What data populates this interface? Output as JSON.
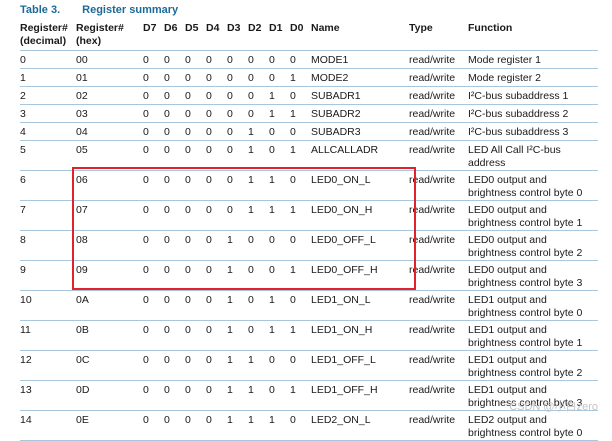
{
  "caption": {
    "label": "Table 3.",
    "title": "Register summary"
  },
  "headers": {
    "decimal": [
      "Register#",
      "(decimal)"
    ],
    "hex": [
      "Register#",
      "(hex)"
    ],
    "bits": [
      "D7",
      "D6",
      "D5",
      "D4",
      "D3",
      "D2",
      "D1",
      "D0"
    ],
    "name": "Name",
    "type": "Type",
    "function": "Function"
  },
  "rows": [
    {
      "dec": "0",
      "hex": "00",
      "bits": [
        "0",
        "0",
        "0",
        "0",
        "0",
        "0",
        "0",
        "0"
      ],
      "name": "MODE1",
      "type": "read/write",
      "fn": [
        "Mode register 1"
      ]
    },
    {
      "dec": "1",
      "hex": "01",
      "bits": [
        "0",
        "0",
        "0",
        "0",
        "0",
        "0",
        "0",
        "1"
      ],
      "name": "MODE2",
      "type": "read/write",
      "fn": [
        "Mode register 2"
      ]
    },
    {
      "dec": "2",
      "hex": "02",
      "bits": [
        "0",
        "0",
        "0",
        "0",
        "0",
        "0",
        "1",
        "0"
      ],
      "name": "SUBADR1",
      "type": "read/write",
      "fn": [
        "I²C-bus subaddress 1"
      ]
    },
    {
      "dec": "3",
      "hex": "03",
      "bits": [
        "0",
        "0",
        "0",
        "0",
        "0",
        "0",
        "1",
        "1"
      ],
      "name": "SUBADR2",
      "type": "read/write",
      "fn": [
        "I²C-bus subaddress 2"
      ]
    },
    {
      "dec": "4",
      "hex": "04",
      "bits": [
        "0",
        "0",
        "0",
        "0",
        "0",
        "1",
        "0",
        "0"
      ],
      "name": "SUBADR3",
      "type": "read/write",
      "fn": [
        "I²C-bus subaddress 3"
      ]
    },
    {
      "dec": "5",
      "hex": "05",
      "bits": [
        "0",
        "0",
        "0",
        "0",
        "0",
        "1",
        "0",
        "1"
      ],
      "name": "ALLCALLADR",
      "type": "read/write",
      "fn": [
        "LED All Call I²C-bus",
        "address"
      ]
    },
    {
      "dec": "6",
      "hex": "06",
      "bits": [
        "0",
        "0",
        "0",
        "0",
        "0",
        "1",
        "1",
        "0"
      ],
      "name": "LED0_ON_L",
      "type": "read/write",
      "fn": [
        "LED0 output and",
        "brightness control byte 0"
      ]
    },
    {
      "dec": "7",
      "hex": "07",
      "bits": [
        "0",
        "0",
        "0",
        "0",
        "0",
        "1",
        "1",
        "1"
      ],
      "name": "LED0_ON_H",
      "type": "read/write",
      "fn": [
        "LED0 output and",
        "brightness control byte 1"
      ]
    },
    {
      "dec": "8",
      "hex": "08",
      "bits": [
        "0",
        "0",
        "0",
        "0",
        "1",
        "0",
        "0",
        "0"
      ],
      "name": "LED0_OFF_L",
      "type": "read/write",
      "fn": [
        "LED0 output and",
        "brightness control byte 2"
      ]
    },
    {
      "dec": "9",
      "hex": "09",
      "bits": [
        "0",
        "0",
        "0",
        "0",
        "1",
        "0",
        "0",
        "1"
      ],
      "name": "LED0_OFF_H",
      "type": "read/write",
      "fn": [
        "LED0 output and",
        "brightness control byte 3"
      ]
    },
    {
      "dec": "10",
      "hex": "0A",
      "bits": [
        "0",
        "0",
        "0",
        "0",
        "1",
        "0",
        "1",
        "0"
      ],
      "name": "LED1_ON_L",
      "type": "read/write",
      "fn": [
        "LED1 output and",
        "brightness control byte 0"
      ]
    },
    {
      "dec": "11",
      "hex": "0B",
      "bits": [
        "0",
        "0",
        "0",
        "0",
        "1",
        "0",
        "1",
        "1"
      ],
      "name": "LED1_ON_H",
      "type": "read/write",
      "fn": [
        "LED1 output and",
        "brightness control byte 1"
      ]
    },
    {
      "dec": "12",
      "hex": "0C",
      "bits": [
        "0",
        "0",
        "0",
        "0",
        "1",
        "1",
        "0",
        "0"
      ],
      "name": "LED1_OFF_L",
      "type": "read/write",
      "fn": [
        "LED1 output and",
        "brightness control byte 2"
      ]
    },
    {
      "dec": "13",
      "hex": "0D",
      "bits": [
        "0",
        "0",
        "0",
        "0",
        "1",
        "1",
        "0",
        "1"
      ],
      "name": "LED1_OFF_H",
      "type": "read/write",
      "fn": [
        "LED1 output and",
        "brightness control byte 3"
      ]
    },
    {
      "dec": "14",
      "hex": "0E",
      "bits": [
        "0",
        "0",
        "0",
        "0",
        "1",
        "1",
        "1",
        "0"
      ],
      "name": "LED2_ON_L",
      "type": "read/write",
      "fn": [
        "LED2 output and",
        "brightness control byte 0"
      ]
    }
  ],
  "highlight": {
    "color": "#e2222a",
    "rows": [
      "6",
      "7",
      "8",
      "9"
    ]
  },
  "watermark": "CSDN @小白zero",
  "colors": {
    "caption": "#1d6a99",
    "rule": "#a8c6dc"
  }
}
